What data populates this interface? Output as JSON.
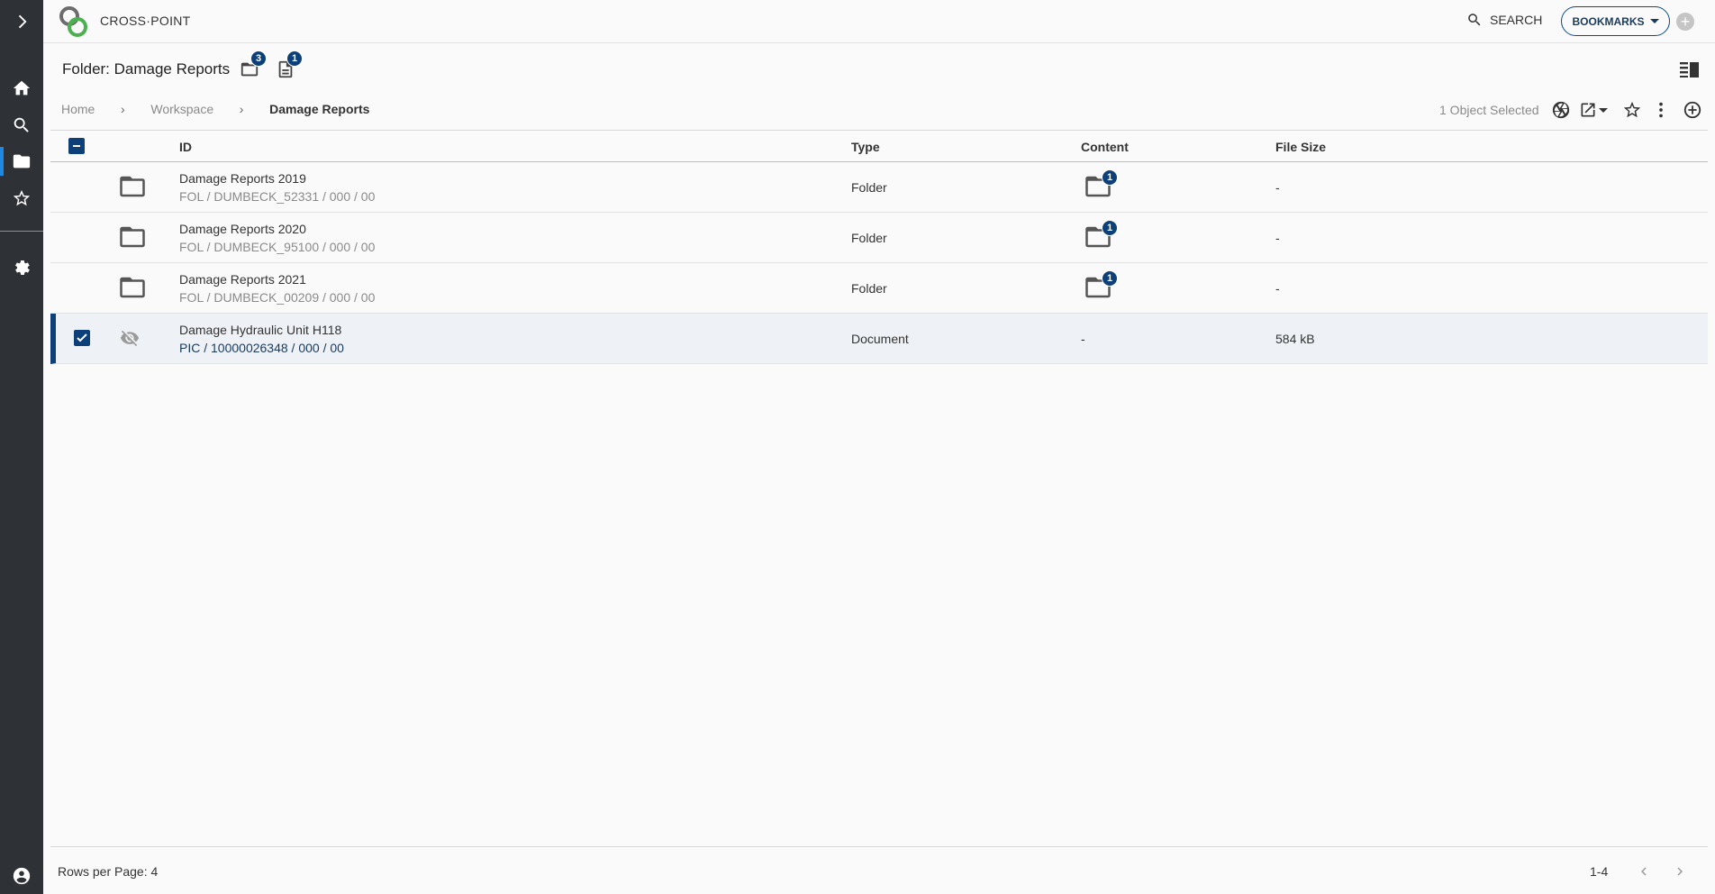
{
  "app": {
    "title": "CROSS·POINT"
  },
  "header": {
    "search_label": "SEARCH",
    "bookmarks_label": "BOOKMARKS"
  },
  "page": {
    "title": "Folder: Damage Reports",
    "folder_count": "3",
    "document_count": "1"
  },
  "breadcrumb": [
    {
      "label": "Home"
    },
    {
      "label": "Workspace"
    },
    {
      "label": "Damage Reports"
    }
  ],
  "actions": {
    "selected_info": "1 Object Selected"
  },
  "table": {
    "columns": {
      "id": "ID",
      "type": "Type",
      "content": "Content",
      "size": "File Size"
    },
    "rows": [
      {
        "name": "Damage Reports 2019",
        "sub": "FOL / DUMBECK_52331 / 000 / 00",
        "type": "Folder",
        "content_badge": "1",
        "size": "-"
      },
      {
        "name": "Damage Reports 2020",
        "sub": "FOL / DUMBECK_95100 / 000 / 00",
        "type": "Folder",
        "content_badge": "1",
        "size": "-"
      },
      {
        "name": "Damage Reports 2021",
        "sub": "FOL / DUMBECK_00209 / 000 / 00",
        "type": "Folder",
        "content_badge": "1",
        "size": "-"
      },
      {
        "name": "Damage Hydraulic Unit H118",
        "sub": "PIC / 10000026348 / 000 / 00",
        "type": "Document",
        "content": "-",
        "size": "584 kB"
      }
    ]
  },
  "footer": {
    "rows_per_page": "Rows per Page: 4",
    "range": "1-4"
  },
  "colors": {
    "sidebar": "#2e3237",
    "accent": "#0d3f78",
    "active_indicator": "#1e88e5"
  }
}
